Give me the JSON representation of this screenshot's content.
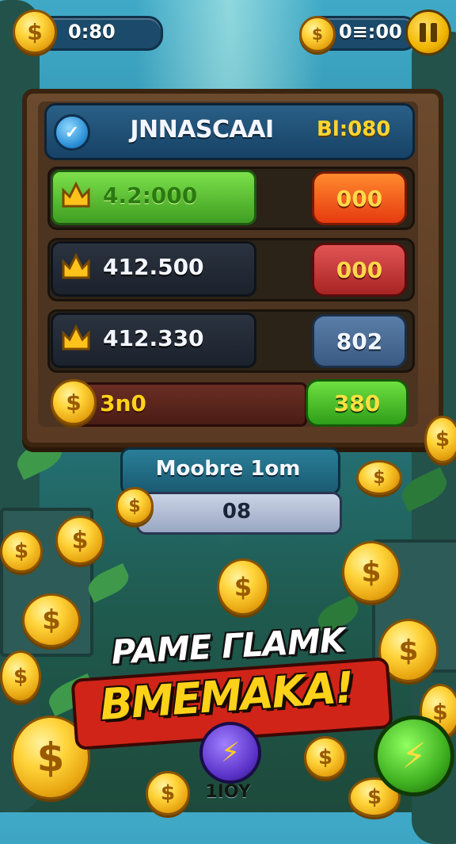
{
  "hud": {
    "left_value": "0:80",
    "right_value": "0≡:00"
  },
  "board": {
    "title": "JNNASCAAI",
    "header_score": "Bl:080",
    "rows": [
      {
        "value": "4.2:000",
        "pill": "000",
        "style": "green"
      },
      {
        "value": "412.500",
        "pill": "000",
        "style": "red"
      },
      {
        "value": "412.330",
        "pill": "802",
        "style": "blue"
      }
    ],
    "bottom": {
      "value": "3n0",
      "pill": "380"
    }
  },
  "mode": {
    "label": "Moobre 1om",
    "value": "08"
  },
  "promo": {
    "line1": "PAME ГLAMK",
    "line2": "BMEMAKA!"
  },
  "buttons": {
    "center_label": "1IOY",
    "center_icon": "lightning-icon",
    "right_icon": "lightning-icon"
  },
  "colors": {
    "gold": "#ffd21a",
    "panel_blue": "#174266",
    "wood": "#5a3a22",
    "banner_red": "#d02418"
  }
}
